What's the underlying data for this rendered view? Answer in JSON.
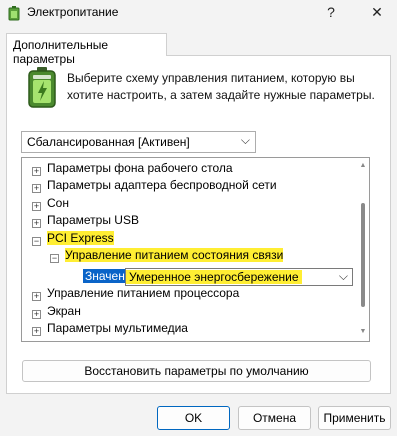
{
  "window": {
    "title": "Электропитание",
    "help_glyph": "?",
    "close_glyph": "✕",
    "icon": "power-options-icon"
  },
  "tab": {
    "label": "Дополнительные параметры"
  },
  "description": "Выберите схему управления питанием, которую вы хотите настроить, а затем задайте нужные параметры.",
  "plan_select": {
    "value": "Сбалансированная [Активен]",
    "chevron": "⌵"
  },
  "tree": {
    "items": [
      {
        "label": "Параметры фона рабочего стола",
        "expander": "+"
      },
      {
        "label": "Параметры адаптера беспроводной сети",
        "expander": "+"
      },
      {
        "label": "Сон",
        "expander": "+"
      },
      {
        "label": "Параметры USB",
        "expander": "+"
      },
      {
        "label": "PCI Express",
        "expander": "−"
      },
      {
        "label": "Управление питанием состояния связи",
        "expander": "−"
      },
      {
        "label": "Управление питанием процессора",
        "expander": "+"
      },
      {
        "label": "Экран",
        "expander": "+"
      },
      {
        "label": "Параметры мультимедиа",
        "expander": "+"
      }
    ],
    "setting": {
      "label": "Значение:",
      "value": "Умеренное энергосбережение",
      "chevron": "⌵"
    },
    "highlight_color": "#ffee33",
    "selection_color": "#0a64c8"
  },
  "buttons": {
    "restore": "Восстановить параметры по умолчанию",
    "ok": "OK",
    "cancel": "Отмена",
    "apply": "Применить"
  }
}
